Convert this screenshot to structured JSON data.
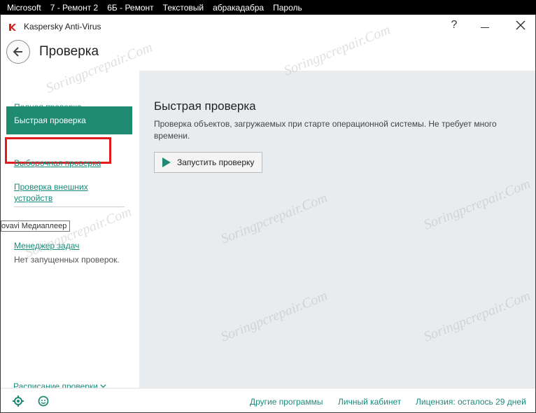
{
  "taskbar": {
    "items": [
      "Microsoft",
      "7 - Ремонт 2",
      "6Б - Ремонт",
      "Текстовый",
      "абракадабра",
      "Пароль"
    ]
  },
  "window": {
    "app_title": "Kaspersky Anti-Virus",
    "help_label": "?"
  },
  "header": {
    "page_title": "Проверка"
  },
  "sidebar": {
    "full_scan": "Полная проверка",
    "quick_scan": "Быстрая проверка",
    "custom_scan": "Выборочная проверка",
    "external_line1": "Проверка внешних",
    "external_line2": "устройств",
    "tooltip": "ovavi Медиаплеер",
    "task_manager": "Менеджер задач",
    "no_scans": "Нет запущенных проверок.",
    "schedule": "Расписание проверки"
  },
  "main": {
    "title": "Быстрая проверка",
    "description": "Проверка объектов, загружаемых при старте операционной системы. Не требует много времени.",
    "run_button": "Запустить проверку"
  },
  "footer": {
    "other_programs": "Другие программы",
    "personal_cabinet": "Личный кабинет",
    "license": "Лицензия: осталось 29 дней"
  },
  "watermark": "Soringpcrepair.Com",
  "colors": {
    "accent": "#1e8a72",
    "link": "#1a8b7a",
    "highlight_border": "#e41b1b",
    "main_bg": "#e9ecef"
  }
}
